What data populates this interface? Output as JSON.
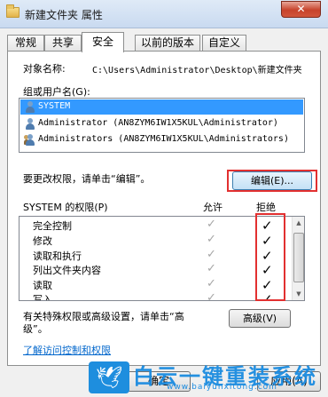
{
  "window": {
    "title": "新建文件夹 属性",
    "close_label": "✕"
  },
  "tabs": [
    {
      "label": "常规",
      "active": false
    },
    {
      "label": "共享",
      "active": false
    },
    {
      "label": "安全",
      "active": true
    },
    {
      "label": "以前的版本",
      "active": false
    },
    {
      "label": "自定义",
      "active": false
    }
  ],
  "security": {
    "object_name_label": "对象名称:",
    "object_name_value": "C:\\Users\\Administrator\\Desktop\\新建文件夹",
    "groups_label": "组或用户名(G):",
    "groups": [
      {
        "name": "SYSTEM",
        "selected": true,
        "icon": "user-icon"
      },
      {
        "name": "Administrator (AN8ZYM6IW1X5KUL\\Administrator)",
        "selected": false,
        "icon": "user-icon"
      },
      {
        "name": "Administrators (AN8ZYM6IW1X5KUL\\Administrators)",
        "selected": false,
        "icon": "users-group-icon"
      }
    ],
    "change_hint": "要更改权限，请单击“编辑”。",
    "edit_button": "编辑(E)...",
    "permissions_label": "SYSTEM 的权限(P)",
    "allow_header": "允许",
    "deny_header": "拒绝",
    "permissions": [
      {
        "name": "完全控制",
        "allow": "✓",
        "deny": "✓"
      },
      {
        "name": "修改",
        "allow": "✓",
        "deny": "✓"
      },
      {
        "name": "读取和执行",
        "allow": "✓",
        "deny": "✓"
      },
      {
        "name": "列出文件夹内容",
        "allow": "✓",
        "deny": "✓"
      },
      {
        "name": "读取",
        "allow": "✓",
        "deny": "✓"
      },
      {
        "name": "写入",
        "allow": "✓",
        "deny": "✓"
      }
    ],
    "advanced_hint_line1": "有关特殊权限或高级设置，请单击“高",
    "advanced_hint_line2": "级”。",
    "advanced_button": "高级(V)",
    "learn_link": "了解访问控制和权限"
  },
  "bottom": {
    "ok_partial": "确定",
    "apply_partial": "应用(A)"
  },
  "watermark": {
    "main": "白云一键重装系统",
    "sub": "www.baiyunxitong.com"
  },
  "colors": {
    "selection": "#3399ff",
    "highlight_box": "#e23030",
    "link": "#0066cc",
    "watermark": "#1a8be0"
  }
}
